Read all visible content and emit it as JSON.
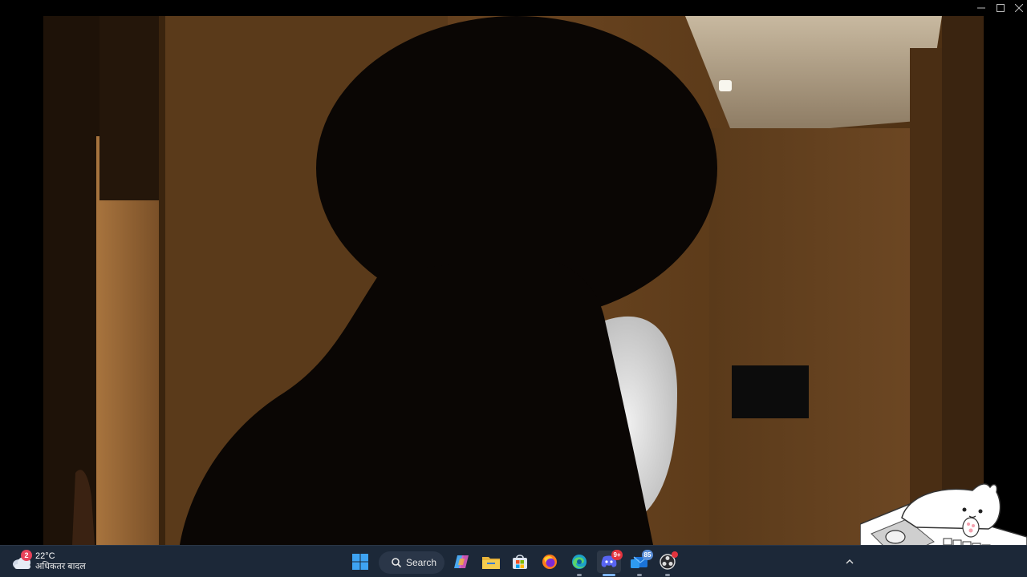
{
  "window": {
    "controls": [
      "minimize-icon",
      "maximize-icon",
      "close-icon"
    ]
  },
  "video": {
    "scene": "dark-hallway-silhouette"
  },
  "taskbar": {
    "weather": {
      "temperature": "22°C",
      "description": "अधिकतर बादल",
      "badge": "2"
    },
    "search": {
      "label": "Search"
    },
    "apps": [
      {
        "name": "start-button",
        "icon": "windows-logo-icon"
      },
      {
        "name": "copilot-button",
        "icon": "copilot-icon"
      },
      {
        "name": "file-explorer-button",
        "icon": "folder-icon"
      },
      {
        "name": "store-button",
        "icon": "store-icon"
      },
      {
        "name": "firefox-button",
        "icon": "firefox-icon"
      },
      {
        "name": "edge-button",
        "icon": "edge-icon"
      },
      {
        "name": "discord-button",
        "icon": "discord-icon",
        "badge": "9+"
      },
      {
        "name": "mail-button",
        "icon": "mail-icon",
        "badge": "85"
      },
      {
        "name": "obs-button",
        "icon": "obs-icon"
      }
    ],
    "tray": {
      "chevron_icon": "chevron-up-icon"
    }
  },
  "colors": {
    "taskbar_bg": "#1c2838",
    "accent": "#7fb6f5",
    "badge_red": "#e3343e"
  }
}
